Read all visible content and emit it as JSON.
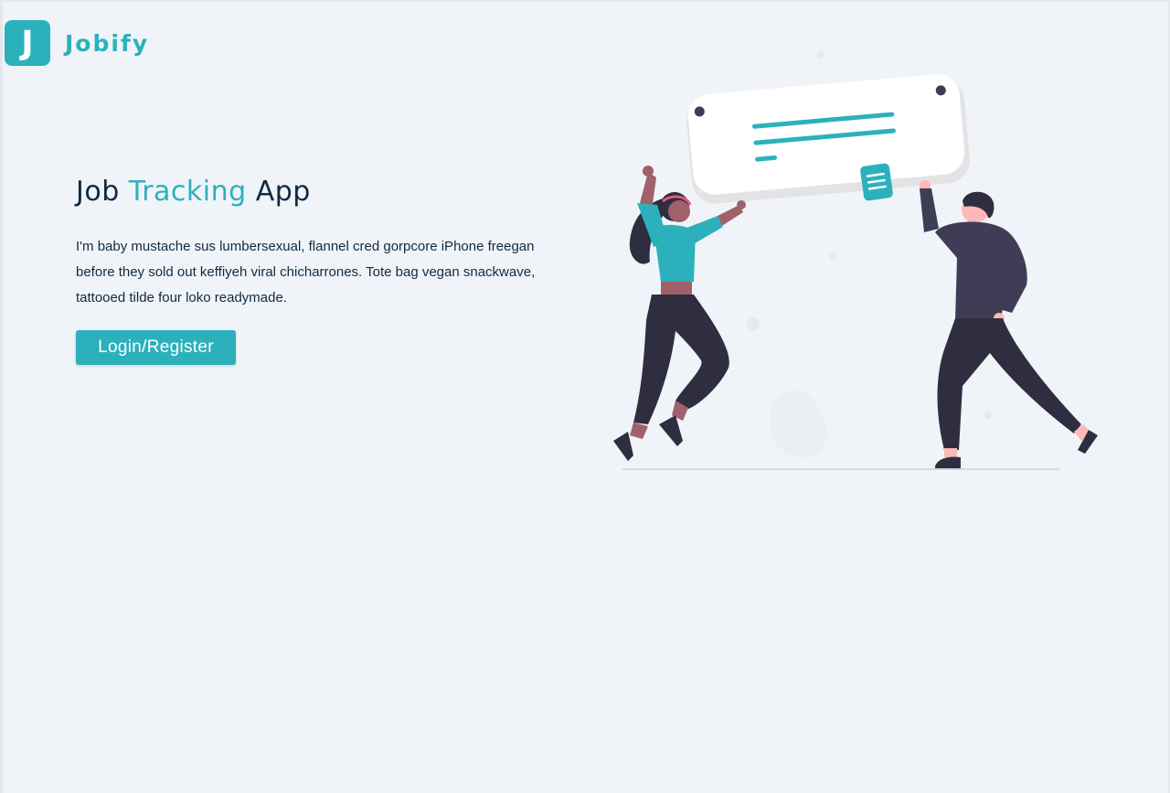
{
  "logo": {
    "letter": "J",
    "name": "Jobify"
  },
  "hero": {
    "title_part1": "Job ",
    "title_accent": "Tracking",
    "title_part2": " App",
    "description": "I'm baby mustache sus lumbersexual, flannel cred gorpcore iPhone freegan before they sold out keffiyeh viral chicharrones. Tote bag vegan snackwave, tattooed tilde four loko readymade.",
    "button_label": "Login/Register"
  },
  "colors": {
    "primary": "#2cb1bc",
    "text": "#102a43",
    "background": "#f0f4f8",
    "dark_figure": "#3f3d56",
    "skin": "#ffb8b8"
  },
  "illustration": {
    "icon": "people-holding-job-card-illustration"
  }
}
